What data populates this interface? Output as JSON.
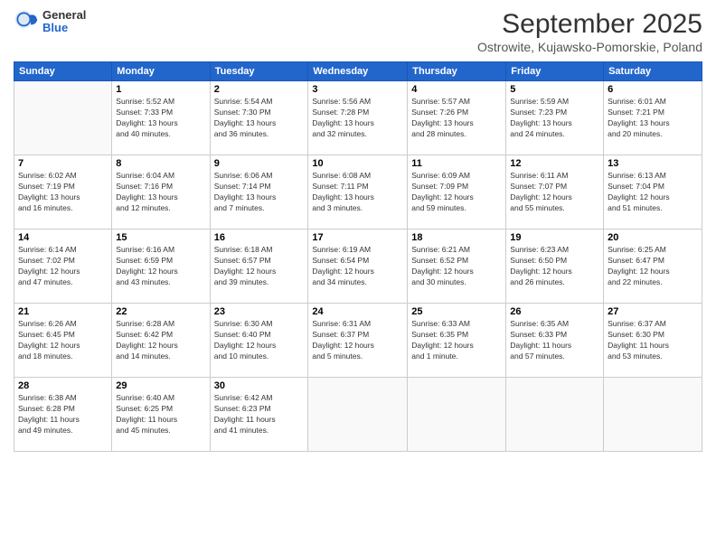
{
  "header": {
    "logo": {
      "general": "General",
      "blue": "Blue"
    },
    "title": "September 2025",
    "subtitle": "Ostrowite, Kujawsko-Pomorskie, Poland"
  },
  "weekdays": [
    "Sunday",
    "Monday",
    "Tuesday",
    "Wednesday",
    "Thursday",
    "Friday",
    "Saturday"
  ],
  "weeks": [
    [
      {
        "day": "",
        "info": ""
      },
      {
        "day": "1",
        "info": "Sunrise: 5:52 AM\nSunset: 7:33 PM\nDaylight: 13 hours\nand 40 minutes."
      },
      {
        "day": "2",
        "info": "Sunrise: 5:54 AM\nSunset: 7:30 PM\nDaylight: 13 hours\nand 36 minutes."
      },
      {
        "day": "3",
        "info": "Sunrise: 5:56 AM\nSunset: 7:28 PM\nDaylight: 13 hours\nand 32 minutes."
      },
      {
        "day": "4",
        "info": "Sunrise: 5:57 AM\nSunset: 7:26 PM\nDaylight: 13 hours\nand 28 minutes."
      },
      {
        "day": "5",
        "info": "Sunrise: 5:59 AM\nSunset: 7:23 PM\nDaylight: 13 hours\nand 24 minutes."
      },
      {
        "day": "6",
        "info": "Sunrise: 6:01 AM\nSunset: 7:21 PM\nDaylight: 13 hours\nand 20 minutes."
      }
    ],
    [
      {
        "day": "7",
        "info": "Sunrise: 6:02 AM\nSunset: 7:19 PM\nDaylight: 13 hours\nand 16 minutes."
      },
      {
        "day": "8",
        "info": "Sunrise: 6:04 AM\nSunset: 7:16 PM\nDaylight: 13 hours\nand 12 minutes."
      },
      {
        "day": "9",
        "info": "Sunrise: 6:06 AM\nSunset: 7:14 PM\nDaylight: 13 hours\nand 7 minutes."
      },
      {
        "day": "10",
        "info": "Sunrise: 6:08 AM\nSunset: 7:11 PM\nDaylight: 13 hours\nand 3 minutes."
      },
      {
        "day": "11",
        "info": "Sunrise: 6:09 AM\nSunset: 7:09 PM\nDaylight: 12 hours\nand 59 minutes."
      },
      {
        "day": "12",
        "info": "Sunrise: 6:11 AM\nSunset: 7:07 PM\nDaylight: 12 hours\nand 55 minutes."
      },
      {
        "day": "13",
        "info": "Sunrise: 6:13 AM\nSunset: 7:04 PM\nDaylight: 12 hours\nand 51 minutes."
      }
    ],
    [
      {
        "day": "14",
        "info": "Sunrise: 6:14 AM\nSunset: 7:02 PM\nDaylight: 12 hours\nand 47 minutes."
      },
      {
        "day": "15",
        "info": "Sunrise: 6:16 AM\nSunset: 6:59 PM\nDaylight: 12 hours\nand 43 minutes."
      },
      {
        "day": "16",
        "info": "Sunrise: 6:18 AM\nSunset: 6:57 PM\nDaylight: 12 hours\nand 39 minutes."
      },
      {
        "day": "17",
        "info": "Sunrise: 6:19 AM\nSunset: 6:54 PM\nDaylight: 12 hours\nand 34 minutes."
      },
      {
        "day": "18",
        "info": "Sunrise: 6:21 AM\nSunset: 6:52 PM\nDaylight: 12 hours\nand 30 minutes."
      },
      {
        "day": "19",
        "info": "Sunrise: 6:23 AM\nSunset: 6:50 PM\nDaylight: 12 hours\nand 26 minutes."
      },
      {
        "day": "20",
        "info": "Sunrise: 6:25 AM\nSunset: 6:47 PM\nDaylight: 12 hours\nand 22 minutes."
      }
    ],
    [
      {
        "day": "21",
        "info": "Sunrise: 6:26 AM\nSunset: 6:45 PM\nDaylight: 12 hours\nand 18 minutes."
      },
      {
        "day": "22",
        "info": "Sunrise: 6:28 AM\nSunset: 6:42 PM\nDaylight: 12 hours\nand 14 minutes."
      },
      {
        "day": "23",
        "info": "Sunrise: 6:30 AM\nSunset: 6:40 PM\nDaylight: 12 hours\nand 10 minutes."
      },
      {
        "day": "24",
        "info": "Sunrise: 6:31 AM\nSunset: 6:37 PM\nDaylight: 12 hours\nand 5 minutes."
      },
      {
        "day": "25",
        "info": "Sunrise: 6:33 AM\nSunset: 6:35 PM\nDaylight: 12 hours\nand 1 minute."
      },
      {
        "day": "26",
        "info": "Sunrise: 6:35 AM\nSunset: 6:33 PM\nDaylight: 11 hours\nand 57 minutes."
      },
      {
        "day": "27",
        "info": "Sunrise: 6:37 AM\nSunset: 6:30 PM\nDaylight: 11 hours\nand 53 minutes."
      }
    ],
    [
      {
        "day": "28",
        "info": "Sunrise: 6:38 AM\nSunset: 6:28 PM\nDaylight: 11 hours\nand 49 minutes."
      },
      {
        "day": "29",
        "info": "Sunrise: 6:40 AM\nSunset: 6:25 PM\nDaylight: 11 hours\nand 45 minutes."
      },
      {
        "day": "30",
        "info": "Sunrise: 6:42 AM\nSunset: 6:23 PM\nDaylight: 11 hours\nand 41 minutes."
      },
      {
        "day": "",
        "info": ""
      },
      {
        "day": "",
        "info": ""
      },
      {
        "day": "",
        "info": ""
      },
      {
        "day": "",
        "info": ""
      }
    ]
  ]
}
